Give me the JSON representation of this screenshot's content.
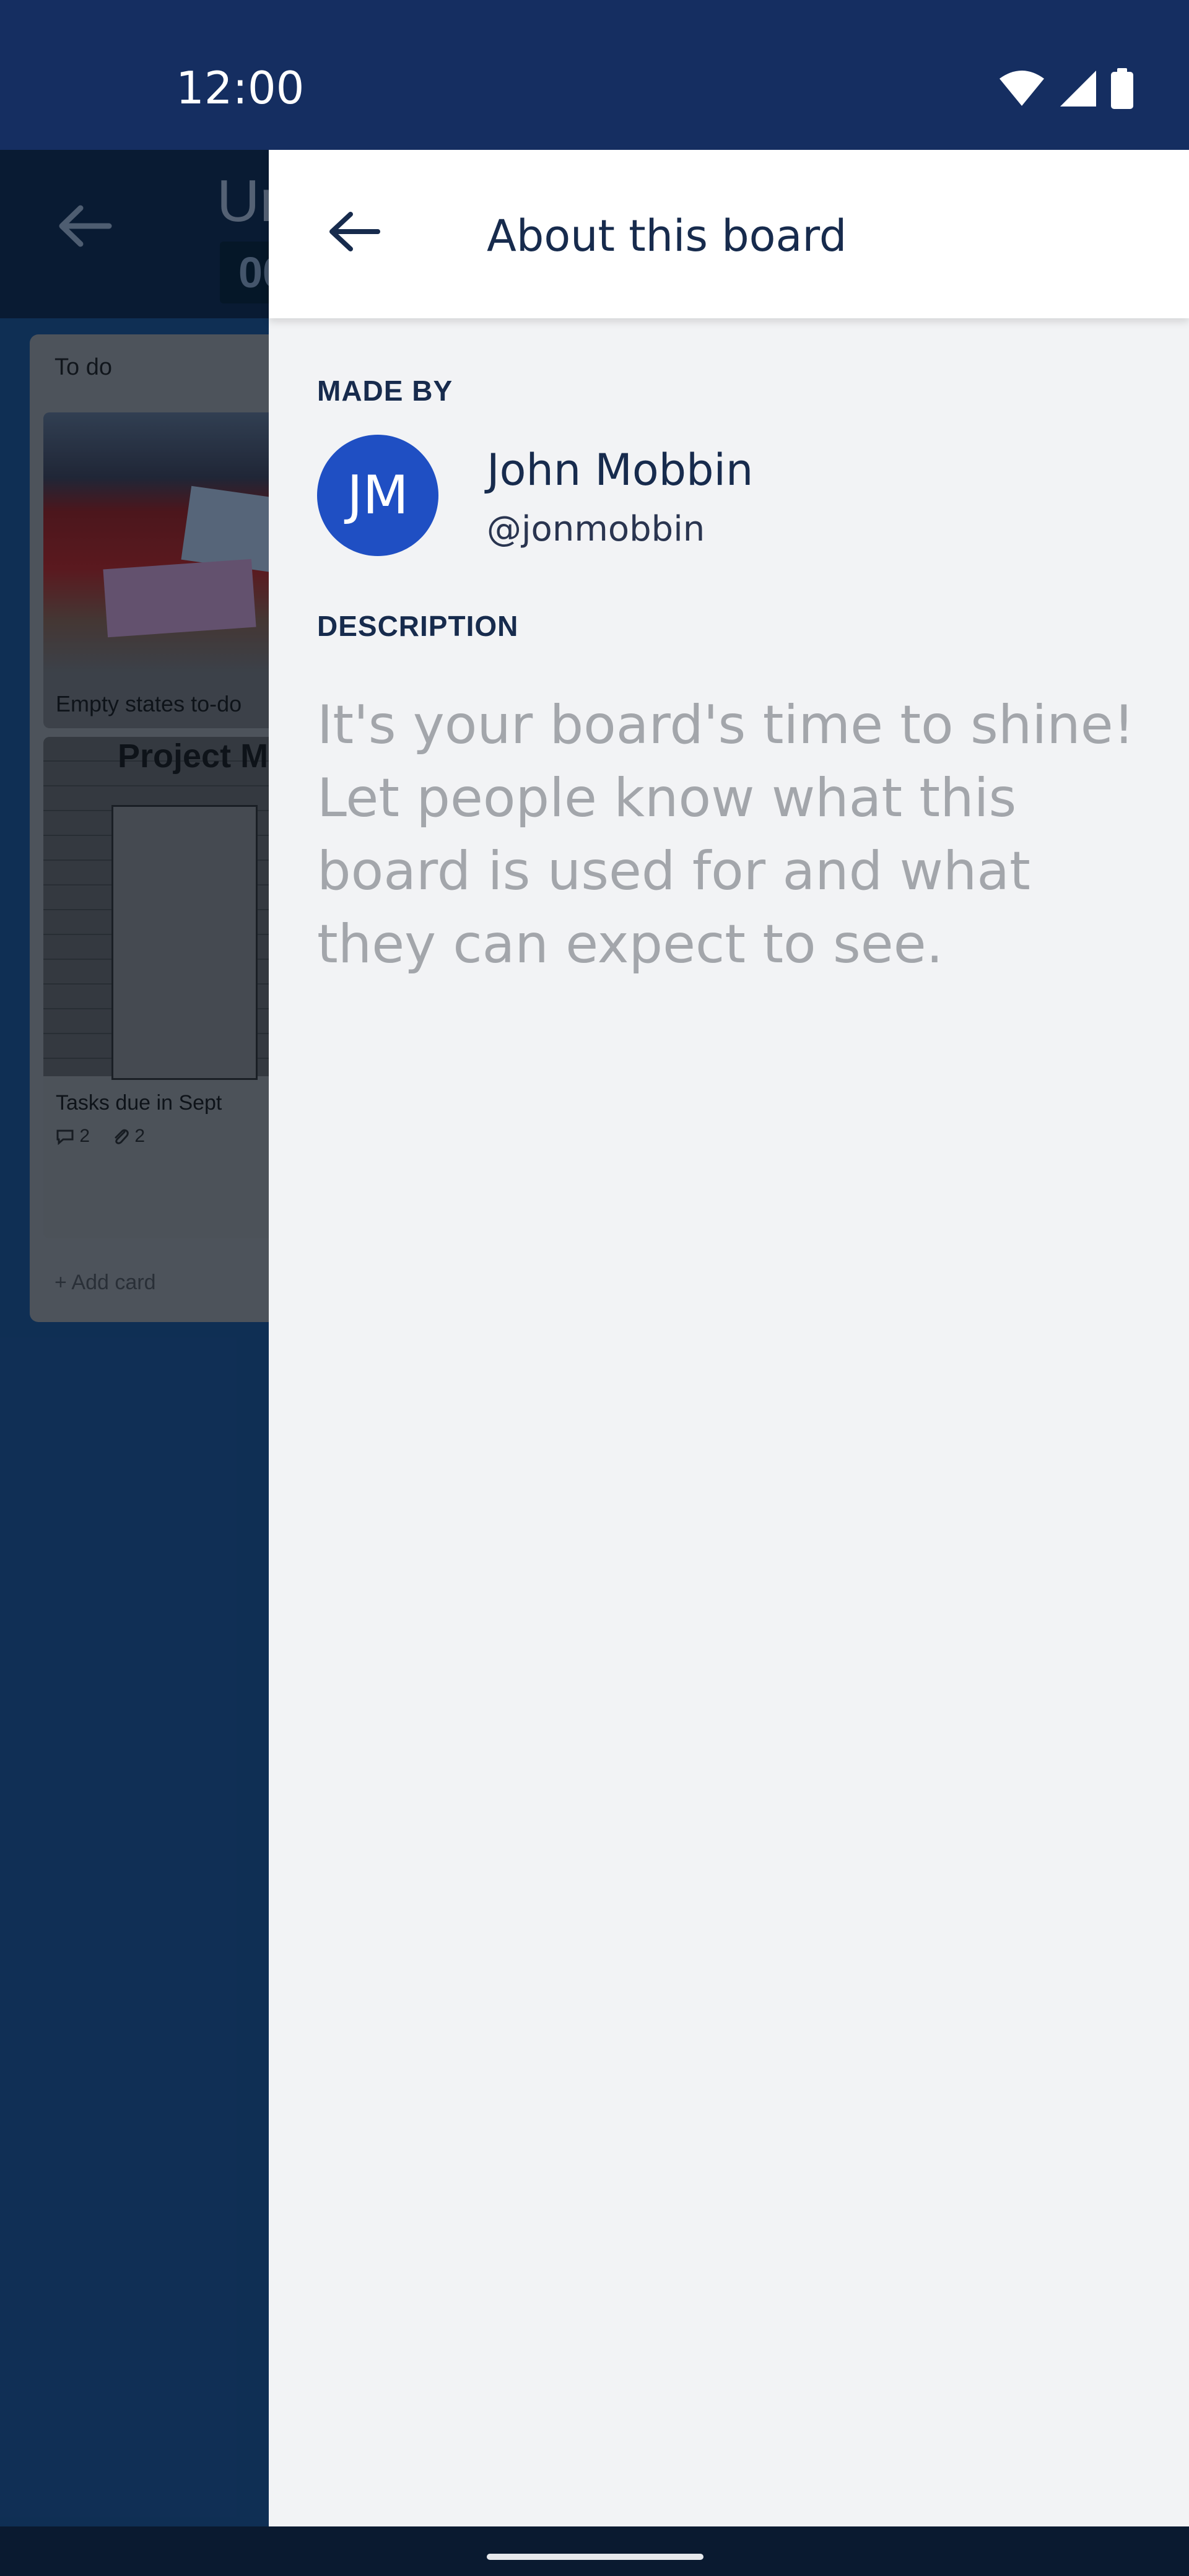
{
  "status_bar": {
    "time": "12:00"
  },
  "background_board": {
    "title_partial": "Ur",
    "title_chip_partial": "00",
    "list": {
      "title": "To do",
      "cards": [
        {
          "label": "Empty states to-do"
        },
        {
          "label": "Tasks due in Sept",
          "image_heading": "Project M",
          "comments": "2",
          "attachments": "2"
        }
      ],
      "add_card_label": "+ Add card"
    }
  },
  "drawer": {
    "title": "About this board",
    "made_by_label": "MADE BY",
    "author": {
      "initials": "JM",
      "name": "John Mobbin",
      "handle": "@jonmobbin",
      "avatar_color": "#1f4fc3"
    },
    "description_label": "DESCRIPTION",
    "description_placeholder": "It's your board's time to shine! Let people know what this board is used for and what they can expect to see."
  },
  "colors": {
    "status_bar": "#152e61",
    "board_background": "#1d4d86",
    "drawer_background": "#f2f3f5",
    "heading_text": "#172b4d",
    "placeholder_text": "#a3a6ab"
  }
}
